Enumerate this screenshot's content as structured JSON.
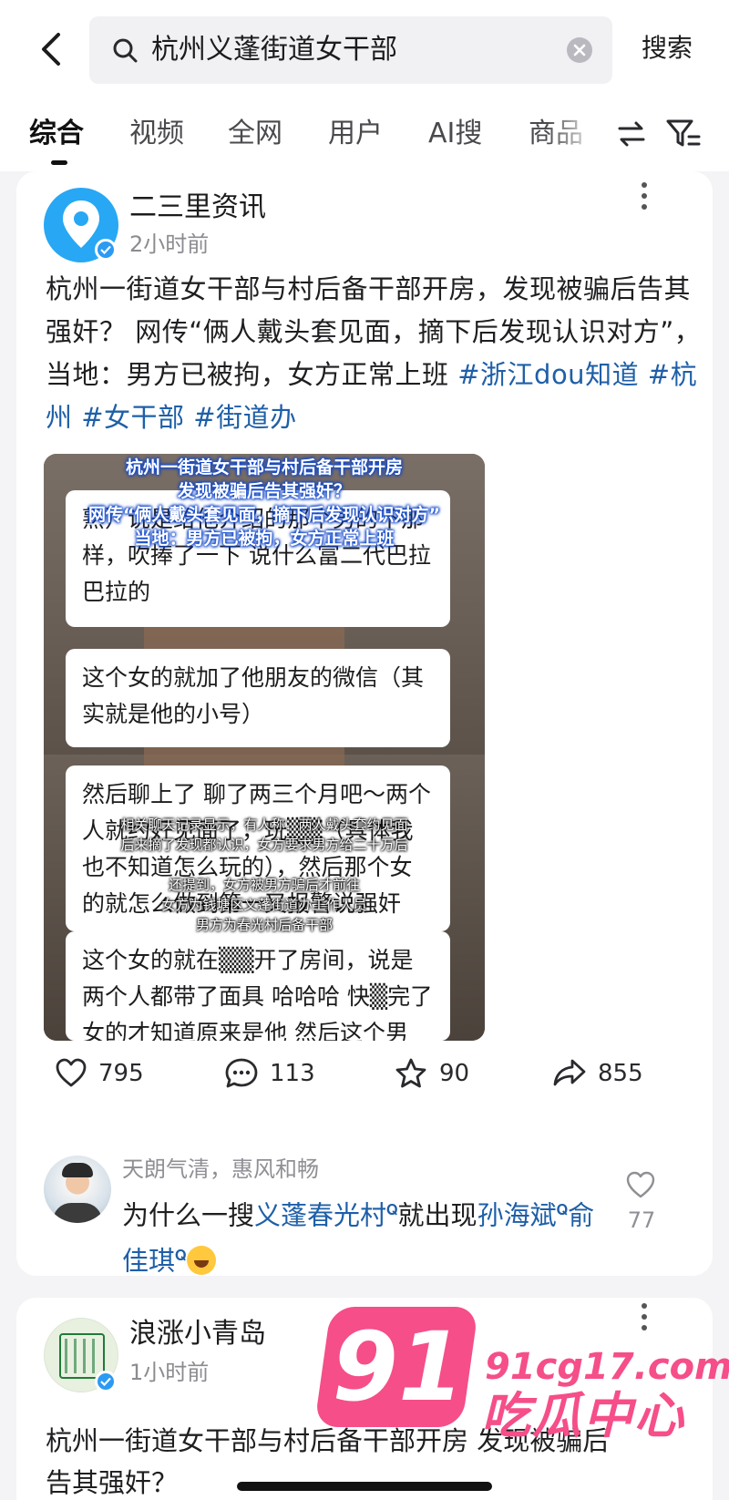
{
  "search": {
    "query": "杭州义蓬街道女干部",
    "button_label": "搜索"
  },
  "tabs": [
    "综合",
    "视频",
    "全网",
    "用户",
    "AI搜",
    "商品"
  ],
  "posts": [
    {
      "author": "二三里资讯",
      "time": "2小时前",
      "body": "杭州一街道女干部与村后备干部开房，发现被骗后告其强奸？ 网传“俩人戴头套见面，摘下后发现认识对方”，当地：男方已被拘，女方正常上班 ",
      "tags": [
        "#浙江dou知道",
        "#杭州",
        "#女干部",
        "#街道办"
      ],
      "media": {
        "title_lines": [
          "杭州一街道女干部与村后备干部开房",
          "发现被骗后告其强奸？",
          "网传“俩人戴头套见面，摘下后发现认识对方”",
          "当地：男方已被拘，女方正常上班"
        ],
        "bubbles": [
          "熟）说是给他介绍的那个男的不那样，吹捧了一下 说什么富二代巴拉巴拉的",
          "这个女的就加了他朋友的微信（其实就是他的小号）",
          "然后聊上了 聊了两三个月吧～两个人就约好见面了，玩▒▒（具体我也不知道怎么玩的），然后那个女的就怎么做到第一又报警说强奸",
          "这个女的就在▒▒开了房间，说是两个人都带了面具 哈哈哈 快▒完了女的才知道原来是他 然后这个男"
        ],
        "subtitle_lines": [
          "相关聊天记录显示，有人称：两人戴头套约见面",
          "后来摘了发现都认识，女方要求男方给二十万后",
          "还提到，女方被男方骗后才前往",
          "女方为钱塘区义蓬街道办工作人员",
          "男方为春光村后备干部"
        ]
      },
      "stats": {
        "likes": "795",
        "comments": "113",
        "favorites": "90",
        "shares": "855"
      },
      "top_comment": {
        "user": "天朗气清，惠风和畅",
        "prefix": "为什么一搜",
        "link1": "义蓬春光村",
        "middle": "就出现",
        "link2": "孙海斌",
        "link3": "俞佳琪",
        "likes": "77"
      }
    },
    {
      "author": "浪涨小青岛",
      "time": "1小时前",
      "body": "杭州一街道女干部与村后备干部开房 发现被骗后告其强奸？"
    }
  ],
  "watermark": {
    "number": "91",
    "url": "91cg17.com",
    "name": "吃瓜中心"
  },
  "colors": {
    "link": "#1e5fa8",
    "verified": "#2b9af3",
    "watermark": "#f54e89"
  }
}
